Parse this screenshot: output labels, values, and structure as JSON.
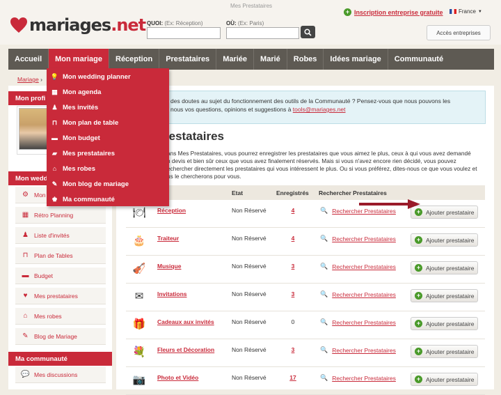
{
  "header": {
    "logo_text_main": "mariages",
    "logo_text_ext": ".net",
    "page_title": "Mes Prestataires",
    "quoi_label": "QUOI:",
    "quoi_hint": "(Ex: Réception)",
    "ou_label": "OÙ:",
    "ou_hint": "(Ex: Paris)",
    "inscription_link": "Inscription entreprise gratuite",
    "language": "France",
    "acces_button": "Accès entreprises"
  },
  "nav": [
    "Accueil",
    "Mon mariage",
    "Réception",
    "Prestataires",
    "Mariée",
    "Marié",
    "Robes",
    "Idées mariage",
    "Communauté"
  ],
  "dropdown": [
    {
      "label": "Mon wedding planner",
      "icon": "lightbulb-icon"
    },
    {
      "label": "Mon agenda",
      "icon": "calendar-icon"
    },
    {
      "label": "Mes invités",
      "icon": "guests-icon"
    },
    {
      "label": "Mon plan de table",
      "icon": "table-icon"
    },
    {
      "label": "Mon budget",
      "icon": "budget-icon"
    },
    {
      "label": "Mes prestataires",
      "icon": "folder-icon"
    },
    {
      "label": "Mes robes",
      "icon": "hanger-icon"
    },
    {
      "label": "Mon blog de mariage",
      "icon": "blog-icon"
    },
    {
      "label": "Ma communauté",
      "icon": "community-icon"
    }
  ],
  "breadcrumb": {
    "home": "Mariage",
    "separator": "›"
  },
  "sidebar": {
    "profile_title": "Mon profi",
    "wedding_title": "Mon wedd",
    "items": [
      {
        "label": "Mon",
        "icon": "gear-icon"
      },
      {
        "label": "Rétro Planning",
        "icon": "calendar-icon"
      },
      {
        "label": "Liste d'invités",
        "icon": "guests-icon"
      },
      {
        "label": "Plan de Tables",
        "icon": "table-icon"
      },
      {
        "label": "Budget",
        "icon": "budget-icon"
      },
      {
        "label": "Mes prestataires",
        "icon": "heart-folder-icon"
      },
      {
        "label": "Mes robes",
        "icon": "hanger-icon"
      },
      {
        "label": "Blog de Mariage",
        "icon": "blog-icon"
      }
    ],
    "community_title": "Ma communauté",
    "community_items": [
      {
        "label": "Mes discussions",
        "icon": "chat-icon"
      }
    ]
  },
  "notice": {
    "line1": "des doutes au sujet du fonctionnement des outils de la Communauté ? Pensez-vous que nous pouvons les",
    "line2_prefix": "nous vos questions, opinions et suggestions à ",
    "email": "tools@mariages.net"
  },
  "main": {
    "heading": "restataires",
    "intro_lines": [
      "ans Mes Prestataires, vous pourrez enregistrer les prestataires que vous aimez le plus, ceux à qui vous avez demandé",
      "n devis et bien sûr ceux que vous avez finalement réservés. Mais si vous n'avez encore rien décidé, vous pouvez",
      "echercher directement les prestataires qui vous intéressent le plus. Ou si vous préférez, dites-nous ce que vous voulez et",
      "us le chercherons pour vous."
    ]
  },
  "table": {
    "headers": {
      "etat": "Etat",
      "enregistres": "Enregistrés",
      "rechercher": "Rechercher Prestataires"
    },
    "rows": [
      {
        "name": "Réception",
        "state": "Non Réservé",
        "count": "4",
        "search": "Rechercher Prestataires",
        "button": "Ajouter prestataire",
        "icon": "reception-icon",
        "linked": true
      },
      {
        "name": "Traiteur",
        "state": "Non Réservé",
        "count": "4",
        "search": "Rechercher Prestataires",
        "button": "Ajouter prestataire",
        "icon": "cake-icon",
        "linked": true
      },
      {
        "name": "Musique",
        "state": "Non Réservé",
        "count": "3",
        "search": "Rechercher Prestataires",
        "button": "Ajouter prestataire",
        "icon": "violin-icon",
        "linked": true
      },
      {
        "name": "Invitations",
        "state": "Non Réservé",
        "count": "3",
        "search": "Rechercher Prestataires",
        "button": "Ajouter prestataire",
        "icon": "envelope-icon",
        "linked": true
      },
      {
        "name": "Cadeaux aux invités",
        "state": "Non Réservé",
        "count": "0",
        "search": "Rechercher Prestataires",
        "button": "Ajouter prestataire",
        "icon": "gift-icon",
        "linked": false
      },
      {
        "name": "Fleurs et Décoration",
        "state": "Non Réservé",
        "count": "3",
        "search": "Rechercher Prestataires",
        "button": "Ajouter prestataire",
        "icon": "flower-icon",
        "linked": true
      },
      {
        "name": "Photo et Vidéo",
        "state": "Non Réservé",
        "count": "17",
        "search": "Rechercher Prestataires",
        "button": "Ajouter prestataire",
        "icon": "camera-icon",
        "linked": true
      }
    ]
  },
  "colors": {
    "brand": "#c92a3a",
    "nav": "#5e5a53",
    "success": "#4a9a2a"
  }
}
